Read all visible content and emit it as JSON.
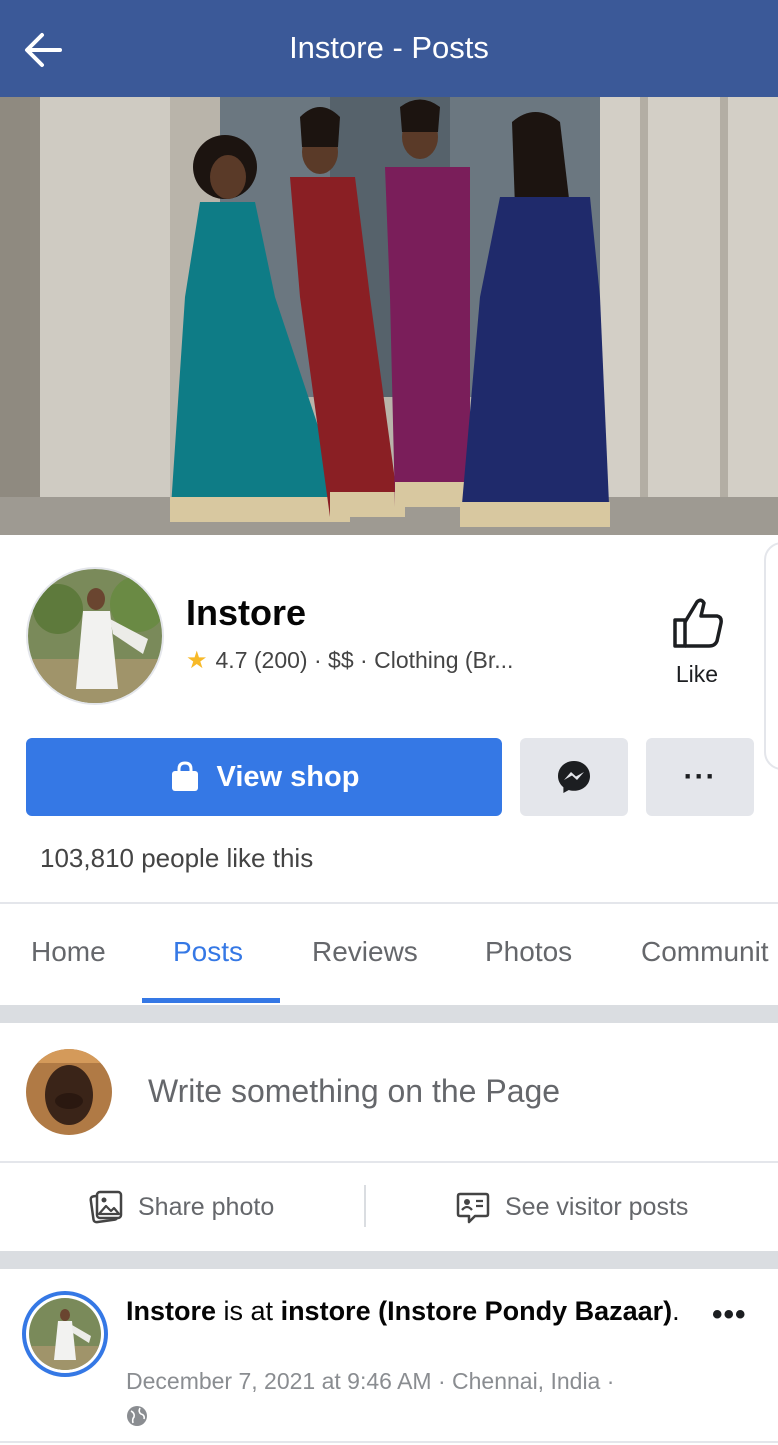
{
  "appbar": {
    "title": "Instore - Posts"
  },
  "page": {
    "name": "Instore",
    "rating": "4.7",
    "reviews_count": "(200)",
    "price": "$$",
    "category": "Clothing (Br...",
    "separator": "·",
    "like_label": "Like"
  },
  "actions": {
    "view_shop": "View shop",
    "more": "···"
  },
  "likes_text": "103,810 people like this",
  "tabs": [
    {
      "label": "Home"
    },
    {
      "label": "Posts"
    },
    {
      "label": "Reviews"
    },
    {
      "label": "Photos"
    },
    {
      "label": "Communit"
    }
  ],
  "active_tab": "Posts",
  "composer": {
    "placeholder": "Write something on the Page"
  },
  "composer_actions": {
    "share_photo": "Share photo",
    "visitor_posts": "See visitor posts"
  },
  "post": {
    "author": "Instore",
    "is_at": " is at ",
    "place": "instore (Instore Pondy Bazaar)",
    "period": ".",
    "meta": "December 7, 2021 at 9:46 AM · Chennai, India ·",
    "more": "•••"
  },
  "colors": {
    "brand_bar": "#3b5998",
    "accent": "#3578e5",
    "star": "#f7b928"
  }
}
